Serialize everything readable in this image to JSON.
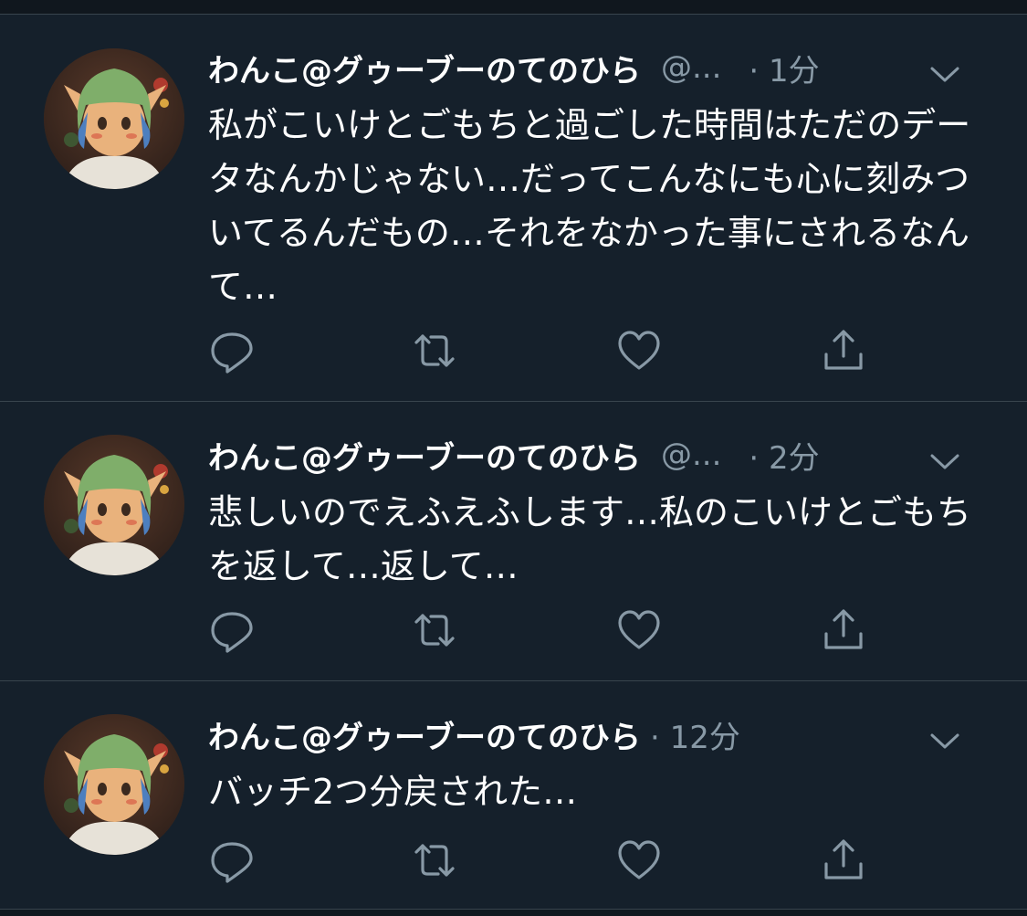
{
  "colors": {
    "background": "#15202b",
    "divider": "#38444d",
    "secondary_text": "#8899a6",
    "primary_text": "#ffffff"
  },
  "tweets": [
    {
      "display_name": "わんこ@グゥーブーのてのひら",
      "handle": "@...",
      "time": "· 1分",
      "text": "私がこいけとごもちと過ごした時間はただのデータなんかじゃない…だってこんなにも心に刻みついてるんだもの…それをなかった事にされるなんて…",
      "icons": [
        "reply-icon",
        "retweet-icon",
        "like-icon",
        "share-icon"
      ]
    },
    {
      "display_name": "わんこ@グゥーブーのてのひら",
      "handle": "@...",
      "time": "· 2分",
      "text": "悲しいのでえふえふします…私のこいけとごもちを返して…返して…",
      "icons": [
        "reply-icon",
        "retweet-icon",
        "like-icon",
        "share-icon"
      ]
    },
    {
      "display_name": "わんこ@グゥーブーのてのひら",
      "handle": "",
      "time": "· 12分",
      "text": "バッチ2つ分戻された…",
      "icons": [
        "reply-icon",
        "retweet-icon",
        "like-icon",
        "share-icon"
      ]
    }
  ]
}
